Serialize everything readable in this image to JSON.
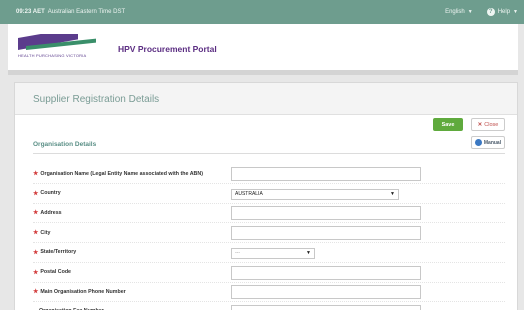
{
  "topbar": {
    "time": "09:23 AET",
    "timezone": "Australian Eastern Time DST",
    "language": "English",
    "help": "Help"
  },
  "header": {
    "logo_text": "HEALTH PURCHASING VICTORIA",
    "title": "HPV Procurement Portal"
  },
  "panel": {
    "title": "Supplier Registration Details",
    "save_label": "Save",
    "close_label": "Close",
    "manual_label": "Manual",
    "section_title": "Organisation Details"
  },
  "fields": [
    {
      "label": "Organisation Name (Legal Entity Name associated with the ABN)",
      "required": true,
      "type": "text",
      "value": ""
    },
    {
      "label": "Country",
      "required": true,
      "type": "select",
      "value": "AUSTRALIA"
    },
    {
      "label": "Address",
      "required": true,
      "type": "text",
      "value": ""
    },
    {
      "label": "City",
      "required": true,
      "type": "text",
      "value": ""
    },
    {
      "label": "State/Territory",
      "required": true,
      "type": "select",
      "value": "---"
    },
    {
      "label": "Postal Code",
      "required": true,
      "type": "text",
      "value": ""
    },
    {
      "label": "Main Organisation Phone Number",
      "required": true,
      "type": "text",
      "value": ""
    },
    {
      "label": "Organisation Fax Number",
      "required": false,
      "type": "text",
      "value": ""
    }
  ],
  "colors": {
    "topbar": "#6e9d8e",
    "title_purple": "#5b2d82",
    "save_green": "#5faa3d",
    "required_red": "#d23b3b"
  }
}
